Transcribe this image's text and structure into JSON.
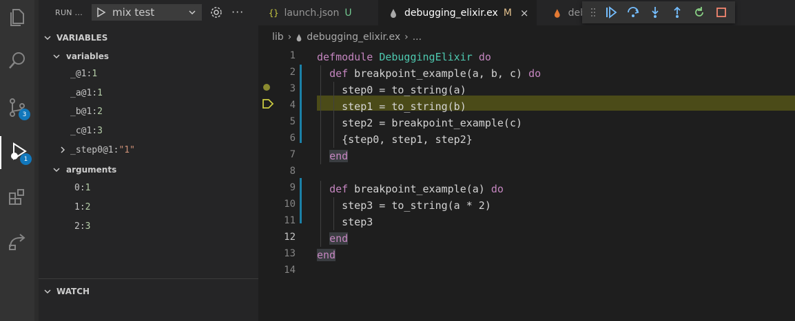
{
  "run_panel": {
    "title": "RUN ...",
    "config": "mix test",
    "more": "···"
  },
  "activity_bar": {
    "items": [
      {
        "icon": "files-icon"
      },
      {
        "icon": "search-icon"
      },
      {
        "icon": "source-control-icon",
        "badge": "3"
      },
      {
        "icon": "run-debug-icon",
        "badge": "1"
      },
      {
        "icon": "extensions-icon"
      },
      {
        "icon": "remote-explorer-icon"
      }
    ]
  },
  "variables": {
    "header": "VARIABLES",
    "scopes": [
      {
        "name": "variables",
        "items": [
          {
            "name": "_@1",
            "value": "1"
          },
          {
            "name": "_a@1",
            "value": "1"
          },
          {
            "name": "_b@1",
            "value": "2"
          },
          {
            "name": "_c@1",
            "value": "3"
          },
          {
            "name": "_step0@1",
            "value": "\"1\""
          }
        ]
      },
      {
        "name": "arguments",
        "items": [
          {
            "name": "0",
            "value": "1"
          },
          {
            "name": "1",
            "value": "2"
          },
          {
            "name": "2",
            "value": "3"
          }
        ]
      }
    ]
  },
  "watch": {
    "header": "WATCH"
  },
  "tabs": [
    {
      "icon": "{}",
      "label": "launch.json",
      "badge": "U"
    },
    {
      "icon": "elixir-drop-icon",
      "label": "debugging_elixir.ex",
      "badge": "M",
      "close": "×"
    },
    {
      "icon": "elixir-drop-icon",
      "label": "deb"
    }
  ],
  "debug_toolbar": {
    "buttons": [
      "continue-icon",
      "step-over-icon",
      "step-into-icon",
      "step-out-icon",
      "restart-icon",
      "stop-icon"
    ]
  },
  "breadcrumb": {
    "folder": "lib",
    "file": "debugging_elixir.ex",
    "symbol": "..."
  },
  "editor": {
    "current_line": 12,
    "breakpoint_line": 3,
    "paused_line": 4,
    "lines": [
      "defmodule DebuggingElixir do",
      "  def breakpoint_example(a, b, c) do",
      "    step0 = to_string(a)",
      "    step1 = to_string(b)",
      "    step2 = breakpoint_example(c)",
      "    {step0, step1, step2}",
      "  end",
      "",
      "  def breakpoint_example(a) do",
      "    step3 = to_string(a * 2)",
      "    step3",
      "  end",
      "end",
      ""
    ],
    "line_numbers": [
      "1",
      "2",
      "3",
      "4",
      "5",
      "6",
      "7",
      "8",
      "9",
      "10",
      "11",
      "12",
      "13",
      "14"
    ]
  },
  "colors": {
    "activity_bg": "#333333",
    "sidebar_bg": "#252526",
    "editor_bg": "#1e1e1e",
    "badge": "#1177bb",
    "paused_highlight": "#4b4b18",
    "modified_gutter": "#1b81a8",
    "keyword": "#c586c0",
    "module": "#4ec9b0"
  }
}
